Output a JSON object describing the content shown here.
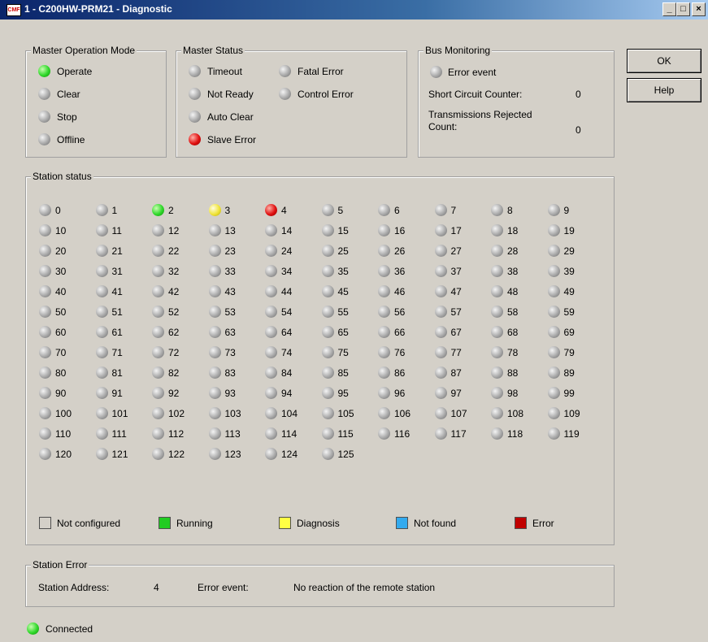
{
  "window": {
    "title": "1 - C200HW-PRM21 - Diagnostic",
    "icon_text": "CMF",
    "controls": {
      "minimize": "_",
      "maximize": "□",
      "close": "×"
    }
  },
  "master_operation_mode": {
    "legend": "Master Operation Mode",
    "items": [
      {
        "label": "Operate",
        "state": "green"
      },
      {
        "label": "Clear",
        "state": "gray"
      },
      {
        "label": "Stop",
        "state": "gray"
      },
      {
        "label": "Offline",
        "state": "gray"
      }
    ]
  },
  "master_status": {
    "legend": "Master Status",
    "items": [
      {
        "label": "Timeout",
        "state": "gray"
      },
      {
        "label": "Not Ready",
        "state": "gray"
      },
      {
        "label": "Auto Clear",
        "state": "gray"
      },
      {
        "label": "Slave Error",
        "state": "red"
      },
      {
        "label": "Fatal Error",
        "state": "gray"
      },
      {
        "label": "Control Error",
        "state": "gray"
      }
    ]
  },
  "bus_monitoring": {
    "legend": "Bus Monitoring",
    "error_event_label": "Error event",
    "short_circuit_label": "Short Circuit Counter:",
    "short_circuit_value": "0",
    "transmissions_rejected_label_1": "Transmissions Rejected",
    "transmissions_rejected_label_2": "Count:",
    "transmissions_rejected_value": "0"
  },
  "buttons": {
    "ok": "OK",
    "help": "Help"
  },
  "station_status": {
    "legend": "Station status",
    "count": 126,
    "states": {
      "2": "green",
      "3": "yellow",
      "4": "red"
    },
    "legend_items": [
      {
        "label": "Not configured",
        "color": "#d4d0c8"
      },
      {
        "label": "Running",
        "color": "#22cc22"
      },
      {
        "label": "Diagnosis",
        "color": "#ffff44"
      },
      {
        "label": "Not found",
        "color": "#33aaee"
      },
      {
        "label": "Error",
        "color": "#c00000"
      }
    ]
  },
  "station_error": {
    "legend": "Station Error",
    "address_label": "Station Address:",
    "address_value": "4",
    "event_label": "Error event:",
    "event_value": "No reaction of the remote station"
  },
  "connection": {
    "label": "Connected",
    "state": "green"
  }
}
